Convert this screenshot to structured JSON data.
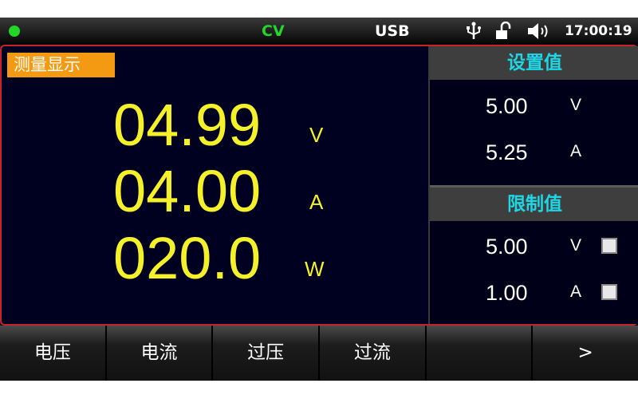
{
  "status": {
    "mode": "CV",
    "interface": "USB",
    "time": "17:00:19",
    "icons": [
      "usb-symbol-icon",
      "unlock-icon",
      "speaker-icon"
    ]
  },
  "measure": {
    "label": "测量显示",
    "voltage": {
      "value": "04.99",
      "unit": "V"
    },
    "current": {
      "value": "04.00",
      "unit": "A"
    },
    "power": {
      "value": "020.0",
      "unit": "W"
    }
  },
  "settings": {
    "title": "设置值",
    "voltage": {
      "value": "5.00",
      "unit": "V"
    },
    "current": {
      "value": "5.25",
      "unit": "A"
    }
  },
  "limits": {
    "title": "限制值",
    "voltage": {
      "value": "5.00",
      "unit": "V",
      "enabled": false
    },
    "current": {
      "value": "1.00",
      "unit": "A",
      "enabled": false
    }
  },
  "softkeys": [
    "电压",
    "电流",
    "过压",
    "过流",
    "",
    ">"
  ],
  "colors": {
    "accent_green": "#22d62a",
    "reading_yellow": "#f4f12a",
    "label_orange": "#f39a12",
    "heading_cyan": "#1ed6e6",
    "border_red": "#c8222c"
  }
}
